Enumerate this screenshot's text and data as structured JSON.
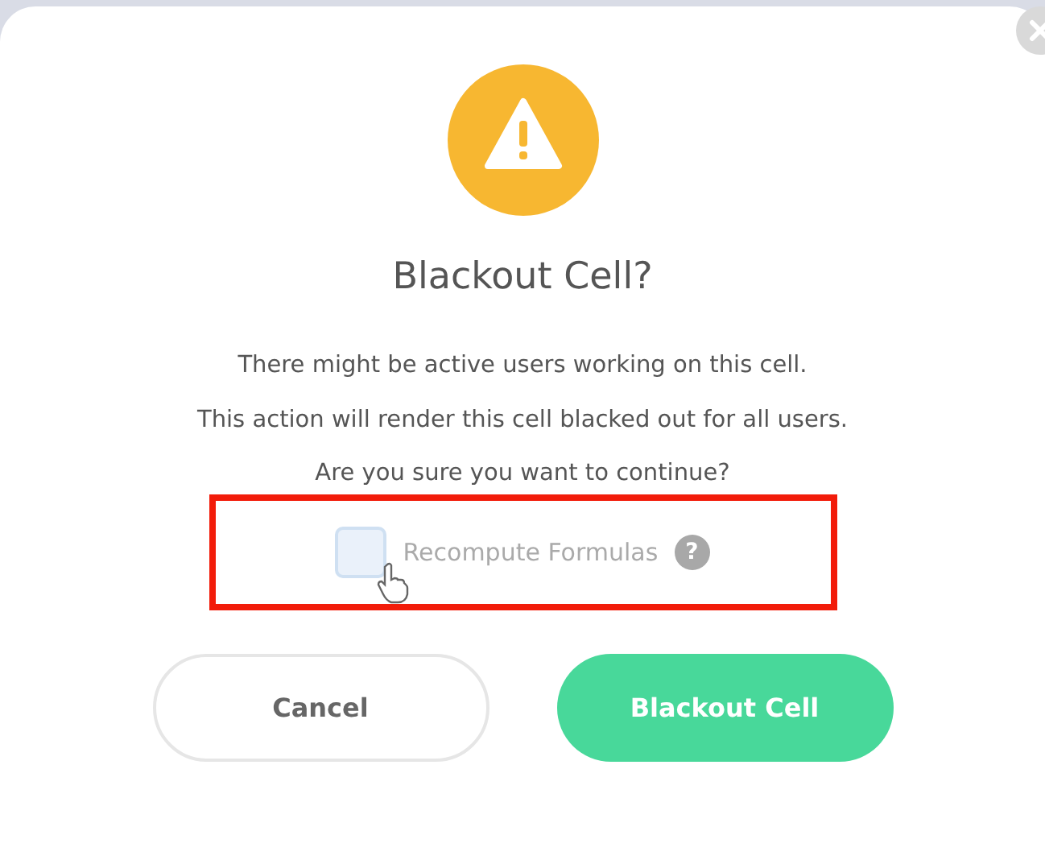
{
  "dialog": {
    "title": "Blackout Cell?",
    "message": [
      "There might be active users working on this cell.",
      "This action will render this cell blacked out for all users.",
      "Are you sure you want to continue?"
    ],
    "option": {
      "label": "Recompute Formulas",
      "checked": false,
      "help": "?",
      "highlighted": true
    },
    "buttons": [
      {
        "label": "Cancel",
        "kind": "secondary"
      },
      {
        "label": "Blackout Cell",
        "kind": "primary"
      }
    ]
  }
}
